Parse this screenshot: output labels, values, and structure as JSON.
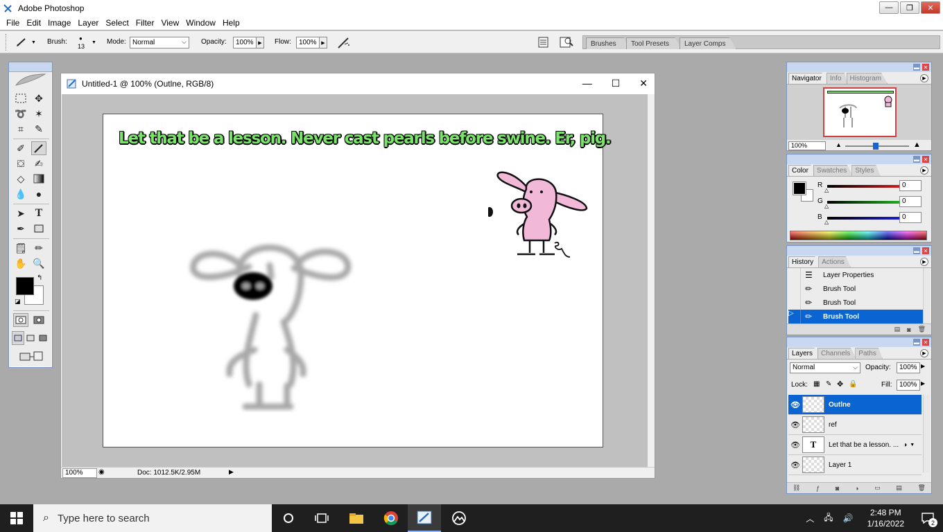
{
  "app": {
    "title": "Adobe Photoshop"
  },
  "window_controls": {
    "minimize": "—",
    "restore": "❐",
    "close": "✕"
  },
  "menu": [
    "File",
    "Edit",
    "Image",
    "Layer",
    "Select",
    "Filter",
    "View",
    "Window",
    "Help"
  ],
  "options": {
    "brush_label": "Brush:",
    "brush_size": "13",
    "mode_label": "Mode:",
    "mode_value": "Normal",
    "opacity_label": "Opacity:",
    "opacity_value": "100%",
    "flow_label": "Flow:",
    "flow_value": "100%"
  },
  "palette_well": {
    "tabs": [
      "Brushes",
      "Tool Presets",
      "Layer Comps"
    ]
  },
  "document": {
    "title": "Untitled-1 @ 100% (Outlne, RGB/8)",
    "zoom": "100%",
    "doc_size": "Doc: 1012.5K/2.95M",
    "caption": "Let that be a lesson. Never cast pearls before swine. Er, pig."
  },
  "navigator": {
    "tabs": [
      "Navigator",
      "Info",
      "Histogram"
    ],
    "zoom": "100%"
  },
  "color": {
    "tabs": [
      "Color",
      "Swatches",
      "Styles"
    ],
    "channels": [
      {
        "label": "R",
        "value": "0",
        "color": "#e02020"
      },
      {
        "label": "G",
        "value": "0",
        "color": "#20c020"
      },
      {
        "label": "B",
        "value": "0",
        "color": "#2020e0"
      }
    ]
  },
  "history": {
    "tabs": [
      "History",
      "Actions"
    ],
    "items": [
      "Layer Properties",
      "Brush Tool",
      "Brush Tool",
      "Brush Tool"
    ],
    "selected_index": 3
  },
  "layers": {
    "tabs": [
      "Layers",
      "Channels",
      "Paths"
    ],
    "blend_mode": "Normal",
    "opacity_label": "Opacity:",
    "opacity_value": "100%",
    "lock_label": "Lock:",
    "fill_label": "Fill:",
    "fill_value": "100%",
    "items": [
      {
        "name": "Outlne",
        "type": "pixel",
        "selected": true
      },
      {
        "name": "ref",
        "type": "pixel",
        "selected": false
      },
      {
        "name": "Let that be a lesson. ...",
        "type": "text",
        "selected": false
      },
      {
        "name": "Layer 1",
        "type": "pixel",
        "selected": false
      }
    ]
  },
  "taskbar": {
    "search_placeholder": "Type here to search",
    "time": "2:48 PM",
    "date": "1/16/2022",
    "notifications": "2"
  },
  "colors": {
    "selection": "#0a64d2",
    "caption_green": "#7ae46a",
    "pig_pink": "#f2b8d8"
  }
}
